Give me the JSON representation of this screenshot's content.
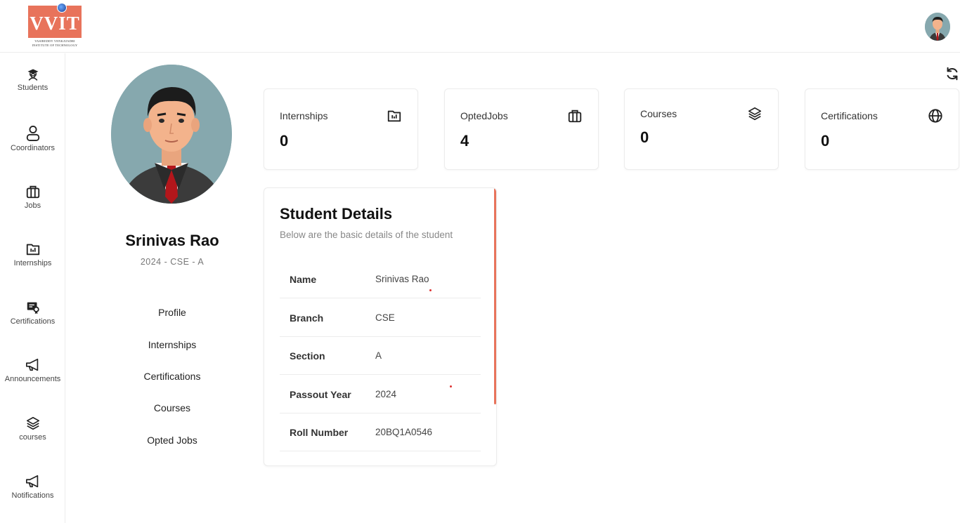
{
  "header": {
    "logo_text": "VVIT",
    "logo_subtext_line1": "VASIREDDY VENKATADRI",
    "logo_subtext_line2": "INSTITUTE OF TECHNOLOGY",
    "avatar_icon": "user-avatar"
  },
  "sidebar": {
    "items": [
      {
        "label": "Students",
        "icon": "graduate-icon"
      },
      {
        "label": "Coordinators",
        "icon": "user-icon"
      },
      {
        "label": "Jobs",
        "icon": "briefcase-icon"
      },
      {
        "label": "Internships",
        "icon": "folder-chart-icon"
      },
      {
        "label": "Certifications",
        "icon": "certificate-icon"
      },
      {
        "label": "Announcements",
        "icon": "megaphone-icon"
      },
      {
        "label": "courses",
        "icon": "layers-icon"
      },
      {
        "label": "Notifications",
        "icon": "megaphone-icon"
      }
    ]
  },
  "profile": {
    "name": "Srinivas Rao",
    "subtitle": "2024 - CSE - A",
    "links": [
      "Profile",
      "Internships",
      "Certifications",
      "Courses",
      "Opted Jobs"
    ]
  },
  "stats": [
    {
      "label": "Internships",
      "value": "0",
      "icon": "folder-chart-icon"
    },
    {
      "label": "OptedJobs",
      "value": "4",
      "icon": "briefcase-icon"
    },
    {
      "label": "Courses",
      "value": "0",
      "icon": "layers-icon"
    },
    {
      "label": "Certifications",
      "value": "0",
      "icon": "globe-icon"
    }
  ],
  "details": {
    "title": "Student Details",
    "subtitle": "Below are the basic details of the student",
    "rows": [
      {
        "key": "Name",
        "value": "Srinivas Rao"
      },
      {
        "key": "Branch",
        "value": "CSE"
      },
      {
        "key": "Section",
        "value": "A"
      },
      {
        "key": "Passout Year",
        "value": "2024"
      },
      {
        "key": "Roll Number",
        "value": "20BQ1A0546"
      }
    ]
  },
  "colors": {
    "brand": "#e8735b",
    "border": "#ececec",
    "avatar_bg": "#86a8ae"
  }
}
